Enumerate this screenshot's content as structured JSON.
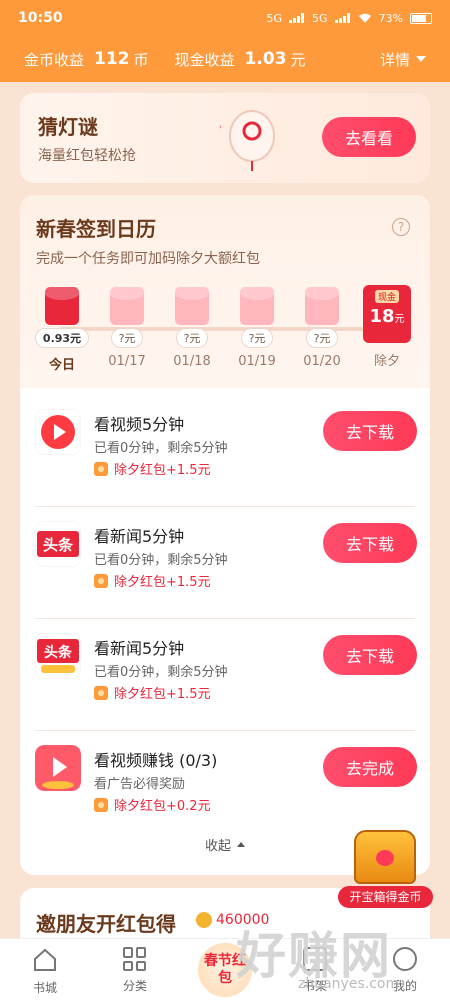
{
  "status_bar": {
    "time": "10:50",
    "network1": "5G",
    "network2": "5G",
    "battery": "73%"
  },
  "earnings": {
    "coin_label": "金币收益",
    "coin_value": "112",
    "coin_unit": "币",
    "cash_label": "现金收益",
    "cash_value": "1.03",
    "cash_unit": "元",
    "detail_label": "详情"
  },
  "riddle_card": {
    "title": "猜灯谜",
    "subtitle": "海量红包轻松抢",
    "button": "去看看"
  },
  "signin": {
    "title": "新春签到日历",
    "help": "?",
    "subtitle": "完成一个任务即可加码除夕大额红包",
    "days": [
      {
        "amount": "0.93元",
        "label": "今日",
        "active": true
      },
      {
        "amount": "?元",
        "label": "01/17",
        "active": false
      },
      {
        "amount": "?元",
        "label": "01/18",
        "active": false
      },
      {
        "amount": "?元",
        "label": "01/19",
        "active": false
      },
      {
        "amount": "?元",
        "label": "01/20",
        "active": false
      }
    ],
    "final": {
      "tag": "现金",
      "value": "18",
      "unit": "元",
      "label": "除夕"
    }
  },
  "tasks": [
    {
      "name": "看视频5分钟",
      "desc": "已看0分钟，剩余5分钟",
      "bonus": "除夕红包+1.5元",
      "button": "去下载",
      "icon": "video-play-icon",
      "color": "#ff3a40"
    },
    {
      "name": "看新闻5分钟",
      "desc": "已看0分钟，剩余5分钟",
      "bonus": "除夕红包+1.5元",
      "button": "去下载",
      "icon": "toutiao-logo-icon",
      "icon_text": "头条",
      "color": "#e8273a"
    },
    {
      "name": "看新闻5分钟",
      "desc": "已看0分钟，剩余5分钟",
      "bonus": "除夕红包+1.5元",
      "button": "去下载",
      "icon": "toutiao-lite-logo-icon",
      "icon_text": "头条",
      "color": "#e8273a"
    },
    {
      "name": "看视频赚钱 (0/3)",
      "desc": "看广告必得奖励",
      "bonus": "除夕红包+0.2元",
      "button": "去完成",
      "icon": "ad-video-icon",
      "color": "#ff5a6a"
    }
  ],
  "collapse_label": "收起",
  "invite_card": {
    "title": "邀朋友开红包得",
    "amount": "460000"
  },
  "chest": {
    "label": "开宝箱得金币"
  },
  "tabbar": {
    "items": [
      {
        "label": "书城",
        "icon": "home-icon"
      },
      {
        "label": "分类",
        "icon": "grid-icon"
      },
      {
        "label": "春节红包",
        "icon": "spring-festival-icon"
      },
      {
        "label": "书架",
        "icon": "bookshelf-icon"
      },
      {
        "label": "我的",
        "icon": "profile-icon"
      }
    ]
  },
  "watermark": {
    "text": "好赚网",
    "url": "zhuanyes.com"
  }
}
